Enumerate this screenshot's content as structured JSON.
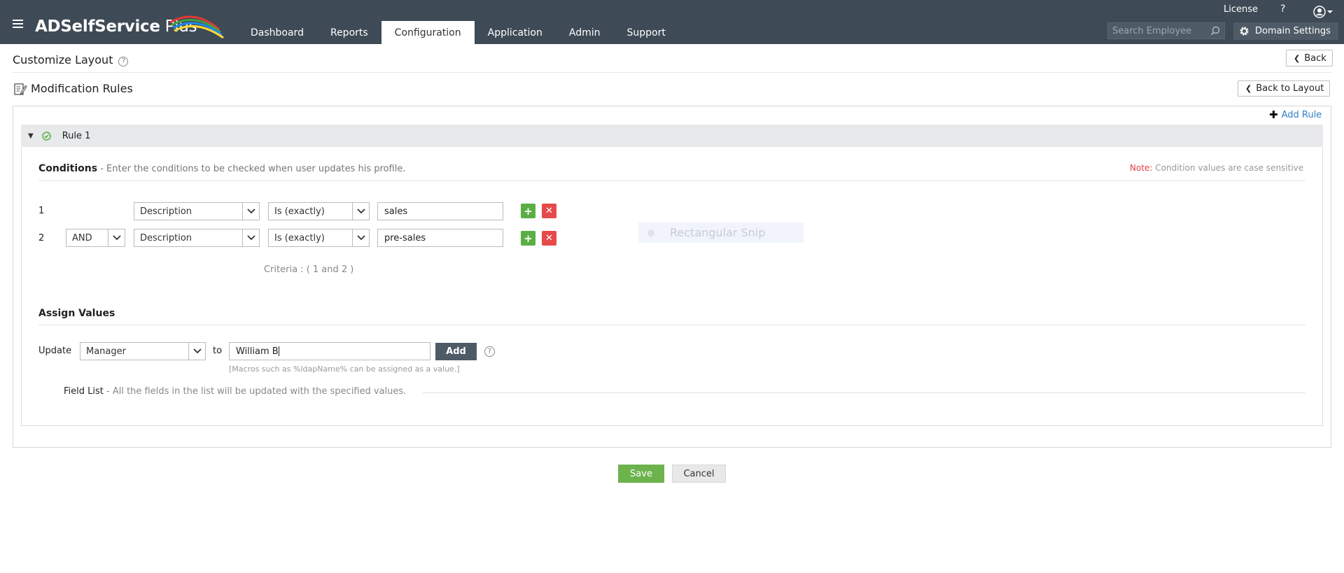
{
  "app": {
    "name_main": "ADSelfService",
    "name_suffix": " Plus"
  },
  "nav": {
    "tabs": [
      {
        "label": "Dashboard"
      },
      {
        "label": "Reports"
      },
      {
        "label": "Configuration",
        "active": true
      },
      {
        "label": "Application"
      },
      {
        "label": "Admin"
      },
      {
        "label": "Support"
      }
    ]
  },
  "top": {
    "license": "License",
    "help": "?",
    "search_placeholder": "Search Employee",
    "domain_settings": "Domain Settings"
  },
  "page": {
    "title": "Customize Layout",
    "back": "Back",
    "subtitle": "Modification Rules",
    "back_to_layout": "Back to Layout"
  },
  "rules": {
    "add_rule": "Add Rule"
  },
  "rule": {
    "name": "Rule 1",
    "conditions_title": "Conditions",
    "conditions_desc": " - Enter the conditions to be checked when user updates his profile.",
    "note_label": "Note:",
    "note_text": " Condition values are case sensitive",
    "conditions": [
      {
        "num": "1",
        "field": "Description",
        "operator": "Is (exactly)",
        "value": "sales"
      },
      {
        "num": "2",
        "logic": "AND",
        "field": "Description",
        "operator": "Is (exactly)",
        "value": "pre-sales"
      }
    ],
    "criteria": "Criteria : ( 1 and 2 )",
    "assign_title": "Assign Values",
    "update_label": "Update",
    "update_field": "Manager",
    "to_label": "to",
    "value": "William B",
    "add_label": "Add",
    "macro_hint": "[Macros such as %ldapName% can be assigned as a value.]",
    "field_list_label": "Field List",
    "field_list_desc": " - All the fields in the list will be updated with the specified values."
  },
  "overlay": {
    "snip_label": "Rectangular Snip"
  },
  "actions": {
    "save": "Save",
    "cancel": "Cancel"
  },
  "colors": {
    "topbar": "#3e4a55",
    "accent_blue": "#2f7ec5",
    "add_green": "#5aae43",
    "delete_red": "#e64b4b",
    "save_green": "#6cb34d"
  }
}
